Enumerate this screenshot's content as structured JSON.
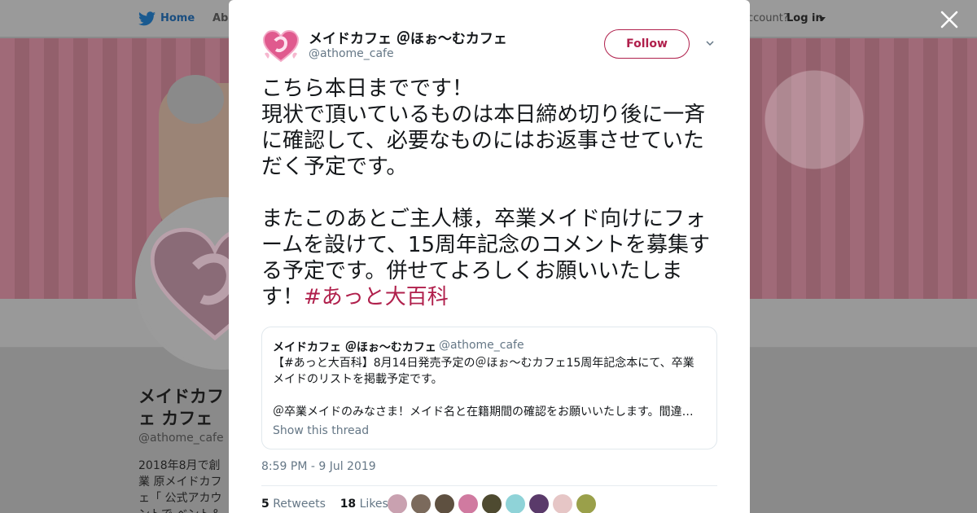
{
  "nav": {
    "home_label": "Home",
    "about_label": "Abo",
    "account_text": "ccount?",
    "login_label": "Log in"
  },
  "profile": {
    "name": "メイドカフェ カフェ",
    "handle": "@athome_cafe",
    "bio": "2018年8月で創業 原メイドカフェ「 公式アカウントで ベント＆新製品情"
  },
  "tweet": {
    "author_name": "メイドカフェ ＠ほぉ～むカフェ",
    "author_handle": "@athome_cafe",
    "follow_label": "Follow",
    "text": "こちら本日までです！\n現状で頂いているものは本日締め切り後に一斉に確認して、必要なものにはお返事させていただく予定です。\n\nまたこのあとご主人様，卒業メイド向けにフォームを設けて、15周年記念のコメントを募集する予定です。併せてよろしくお願いいたします！",
    "hashtag": "#あっと大百科",
    "timestamp": "8:59 PM - 9 Jul 2019",
    "retweets_count": "5",
    "retweets_label": "Retweets",
    "likes_count": "18",
    "likes_label": "Likes"
  },
  "quoted": {
    "author_name": "メイドカフェ ＠ほぉ～むカフェ",
    "author_handle": "@athome_cafe",
    "text": "【#あっと大百科】8月14日発売予定の＠ほぉ～むカフェ15周年記念本にて、卒業メイドのリストを掲載予定です。\n\n＠卒業メイドのみなさま！メイド名と在籍期間の確認をお願いいたします。間違…",
    "thread_link": "Show this thread"
  },
  "colors": {
    "accent": "#b0204c",
    "twitter_blue": "#1da1f2",
    "secondary_text": "#657786"
  },
  "icons": {
    "bird": "twitter-bird-icon",
    "close": "close-icon",
    "caret": "chevron-down-icon"
  }
}
